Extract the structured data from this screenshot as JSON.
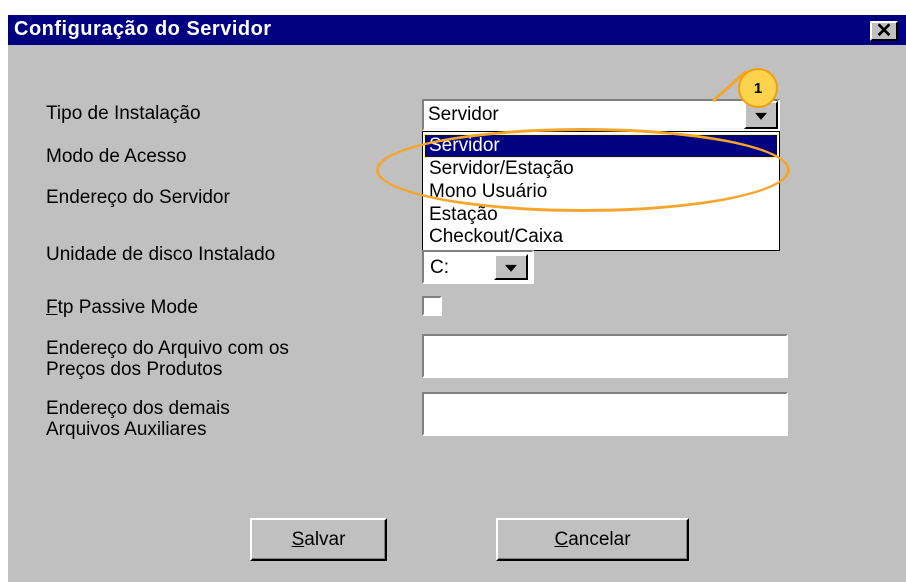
{
  "window": {
    "title": "Configuração do Servidor",
    "close_glyph": "✕"
  },
  "labels": {
    "tipo_instalacao": "Tipo de Instalação",
    "modo_acesso": "Modo de Acesso",
    "endereco_servidor": "Endereço do Servidor",
    "unidade_disco": "Unidade de disco Instalado",
    "ftp_passive_accel": "F",
    "ftp_passive_rest": "tp Passive Mode",
    "endereco_precos_line1": "Endereço do Arquivo com os",
    "endereco_precos_line2": "Preços dos Produtos",
    "endereco_aux_line1": "Endereço dos demais",
    "endereco_aux_line2": "Arquivos Auxiliares"
  },
  "tipo_instalacao_combo": {
    "value": "Servidor",
    "options": [
      "Servidor",
      "Servidor/Estação",
      "Mono Usuário",
      "Estação",
      "Checkout/Caixa"
    ],
    "selected_index": 0
  },
  "unidade_disco_combo": {
    "value": "C:"
  },
  "ftp_passive_checked": false,
  "inputs": {
    "endereco_precos": "",
    "endereco_aux": ""
  },
  "buttons": {
    "salvar_accel": "S",
    "salvar_rest": "alvar",
    "cancelar_accel": "C",
    "cancelar_rest": "ancelar"
  },
  "annotation": {
    "badge_number": "1",
    "color": "#f4a52a"
  },
  "colors": {
    "titlebar": "#000080",
    "dialog_bg": "#c0c0c0",
    "selection": "#000080"
  },
  "icons": {
    "close": "close-icon",
    "dropdown": "chevron-down-icon"
  }
}
